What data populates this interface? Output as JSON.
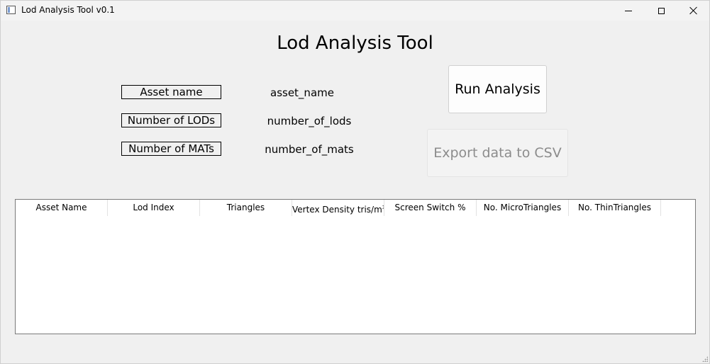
{
  "window": {
    "title": "Lod Analysis Tool v0.1"
  },
  "heading": "Lod Analysis Tool",
  "info": [
    {
      "label": "Asset name",
      "value": "asset_name"
    },
    {
      "label": "Number of LODs",
      "value": "number_of_lods"
    },
    {
      "label": "Number of MATs",
      "value": "number_of_mats"
    }
  ],
  "buttons": {
    "run": "Run Analysis",
    "export": "Export data to CSV",
    "export_enabled": false
  },
  "table": {
    "columns": [
      "Asset Name",
      "Lod Index",
      "Triangles",
      "Vertex Density tris/m",
      "Screen Switch %",
      "No. MicroTriangles",
      "No. ThinTriangles"
    ],
    "column_superscripts": {
      "3": "3"
    },
    "rows": []
  }
}
